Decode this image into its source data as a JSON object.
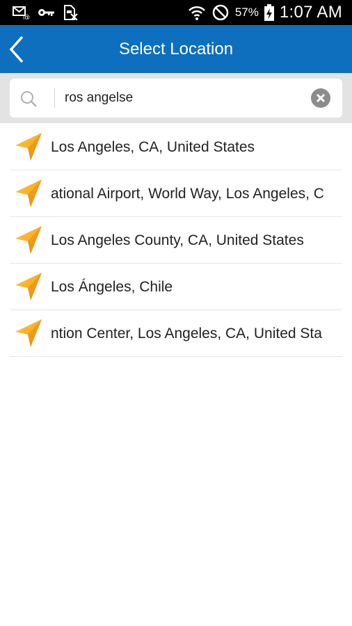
{
  "status_bar": {
    "icons_left": [
      "email-notification-icon",
      "key-icon",
      "sim-card-icon"
    ],
    "icons_right": [
      "wifi-icon",
      "do-not-disturb-icon",
      "battery-charging-icon"
    ],
    "battery": "57%",
    "time": "1:07 AM"
  },
  "header": {
    "title": "Select Location",
    "back_icon": "chevron-left-icon",
    "background_color": "#0d6fbe"
  },
  "search": {
    "value": "ros angelse",
    "search_icon": "search-icon",
    "clear_icon": "clear-icon"
  },
  "results": [
    {
      "label": "Los Angeles, CA, United States",
      "icon": "location-arrow-icon",
      "clipped_start": false
    },
    {
      "label": "ational Airport, World Way, Los Angeles, C",
      "icon": "location-arrow-icon",
      "clipped_start": true
    },
    {
      "label": "Los Angeles County, CA, United States",
      "icon": "location-arrow-icon",
      "clipped_start": false
    },
    {
      "label": "Los Ángeles, Chile",
      "icon": "location-arrow-icon",
      "clipped_start": false
    },
    {
      "label": "ntion Center, Los Angeles, CA, United Sta",
      "icon": "location-arrow-icon",
      "clipped_start": true
    }
  ],
  "colors": {
    "accent": "#0d6fbe",
    "icon_orange": "#f7a21b"
  }
}
